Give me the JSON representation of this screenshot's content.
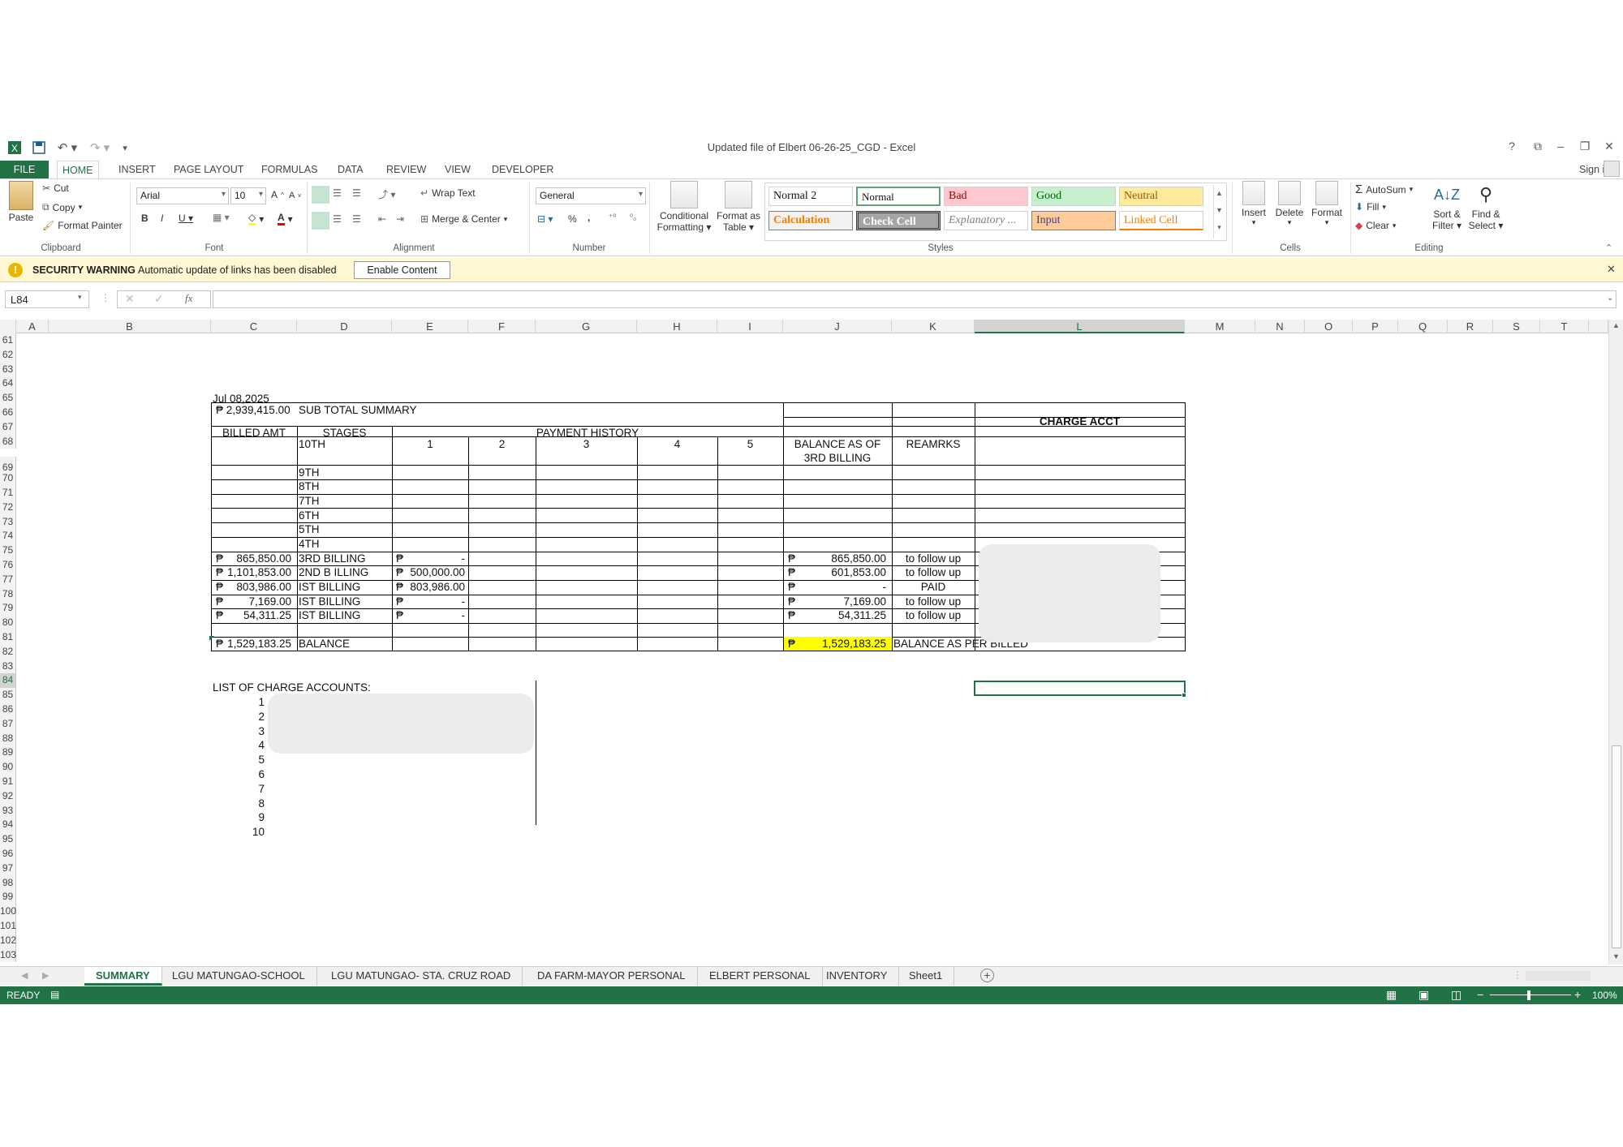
{
  "window": {
    "title": "Updated file of Elbert 06-26-25_CGD - Excel",
    "help": "?",
    "sign_in": "Sign in"
  },
  "ribbon_tabs": [
    "FILE",
    "HOME",
    "INSERT",
    "PAGE LAYOUT",
    "FORMULAS",
    "DATA",
    "REVIEW",
    "VIEW",
    "DEVELOPER"
  ],
  "clipboard": {
    "paste": "Paste",
    "cut": "Cut",
    "copy": "Copy",
    "format_painter": "Format Painter",
    "label": "Clipboard"
  },
  "font": {
    "name": "Arial",
    "size": "10",
    "label": "Font"
  },
  "alignment": {
    "wrap": "Wrap Text",
    "merge": "Merge & Center",
    "label": "Alignment"
  },
  "number": {
    "format": "General",
    "percent": "%",
    "comma": ",",
    "label": "Number"
  },
  "styles": {
    "conditional": "Conditional",
    "conditional2": "Formatting",
    "format_as": "Format as",
    "format_as2": "Table",
    "cells": [
      {
        "text": "Normal 2",
        "bg": "#ffffff",
        "fg": "#111111"
      },
      {
        "text": "Normal",
        "bg": "#ffffff",
        "fg": "#111111"
      },
      {
        "text": "Bad",
        "bg": "#ffc7ce",
        "fg": "#9c0006"
      },
      {
        "text": "Good",
        "bg": "#c6efce",
        "fg": "#006100"
      },
      {
        "text": "Neutral",
        "bg": "#ffeb9c",
        "fg": "#9c5700"
      },
      {
        "text": "Calculation",
        "bg": "#f2f2f2",
        "fg": "#fa7d00"
      },
      {
        "text": "Check Cell",
        "bg": "#a5a5a5",
        "fg": "#ffffff"
      },
      {
        "text": "Explanatory ...",
        "bg": "#ffffff",
        "fg": "#7f7f7f"
      },
      {
        "text": "Input",
        "bg": "#ffcc99",
        "fg": "#3f3f76"
      },
      {
        "text": "Linked Cell",
        "bg": "#ffffff",
        "fg": "#fa7d00"
      }
    ],
    "label": "Styles"
  },
  "cells_group": {
    "insert": "Insert",
    "delete": "Delete",
    "format": "Format",
    "label": "Cells"
  },
  "editing": {
    "autosum": "AutoSum",
    "fill": "Fill",
    "clear": "Clear",
    "sort": "Sort &",
    "sort2": "Filter",
    "find": "Find &",
    "find2": "Select",
    "label": "Editing"
  },
  "security": {
    "title": "SECURITY WARNING",
    "message": "Automatic update of links has been disabled",
    "button": "Enable Content"
  },
  "formula_bar": {
    "name_box": "L84",
    "fx": "fx",
    "value": ""
  },
  "columns": [
    "A",
    "B",
    "C",
    "D",
    "E",
    "F",
    "G",
    "H",
    "I",
    "J",
    "K",
    "L",
    "M",
    "N",
    "O",
    "P",
    "Q",
    "R",
    "S",
    "T"
  ],
  "rows": [
    "61",
    "62",
    "63",
    "64",
    "65",
    "66",
    "67",
    "68",
    "69",
    "70",
    "71",
    "72",
    "73",
    "74",
    "75",
    "76",
    "77",
    "78",
    "79",
    "80",
    "81",
    "82",
    "83",
    "84",
    "85",
    "86",
    "87",
    "88",
    "89",
    "90",
    "91",
    "92",
    "93",
    "94",
    "95",
    "96",
    "97",
    "98",
    "99",
    "100",
    "101",
    "102",
    "103"
  ],
  "sheet": {
    "date": "Jul 08,2025",
    "subtotal_value": "₱ 2,939,415.00",
    "subtotal_label": "SUB TOTAL SUMMARY",
    "charge_acct": "CHARGE ACCT",
    "h_billed": "BILLED AMT",
    "h_stages": "STAGES",
    "h_payment": "PAYMENT HISTORY",
    "h_balance1": "BALANCE AS OF",
    "h_balance2": "3RD BILLING",
    "h_remarks": "REAMRKS",
    "pay_cols": [
      "1",
      "2",
      "3",
      "4",
      "5"
    ],
    "stages_top": [
      "10TH",
      "9TH",
      "8TH",
      "7TH",
      "6TH",
      "5TH",
      "4TH"
    ],
    "peso": "₱",
    "data_rows": [
      {
        "billed": "865,850.00",
        "stage": "3RD BILLING",
        "pay1": "-",
        "balance": "865,850.00",
        "remark": "to follow up"
      },
      {
        "billed": "1,101,853.00",
        "stage": "2ND B ILLING",
        "pay1": "500,000.00",
        "balance": "601,853.00",
        "remark": "to follow up"
      },
      {
        "billed": "803,986.00",
        "stage": "IST BILLING",
        "pay1": "803,986.00",
        "balance": "-",
        "remark": "PAID"
      },
      {
        "billed": "7,169.00",
        "stage": "IST BILLING",
        "pay1": "-",
        "balance": "7,169.00",
        "remark": "to follow up"
      },
      {
        "billed": "54,311.25",
        "stage": "IST BILLING",
        "pay1": "-",
        "balance": "54,311.25",
        "remark": "to follow up"
      }
    ],
    "balance_row": {
      "billed": "1,529,183.25",
      "stage": "BALANCE",
      "balance": "1,529,183.25",
      "remark": "BALANCE AS PER BILLED"
    },
    "list_title": "LIST OF CHARGE ACCOUNTS:",
    "list_numbers": [
      "1",
      "2",
      "3",
      "4",
      "5",
      "6",
      "7",
      "8",
      "9",
      "10"
    ]
  },
  "sheet_tabs": [
    "SUMMARY",
    "LGU MATUNGAO-SCHOOL",
    "LGU MATUNGAO- STA. CRUZ ROAD",
    "DA FARM-MAYOR PERSONAL",
    "ELBERT PERSONAL",
    "INVENTORY",
    "Sheet1"
  ],
  "status": {
    "ready": "READY",
    "zoom": "100%"
  },
  "colors": {
    "accent": "#217346",
    "highlight": "#ffff00",
    "warning_bg": "#fff7d1"
  }
}
